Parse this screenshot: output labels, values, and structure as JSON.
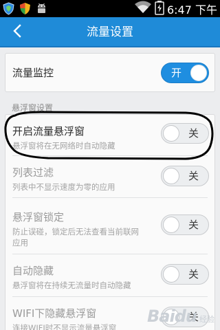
{
  "status_bar": {
    "time": "6:47 下午",
    "icons": [
      "shield-icon",
      "security-icon",
      "android-icon",
      "wifi-icon",
      "battery-charging-icon"
    ]
  },
  "header": {
    "title": "流量设置",
    "back_icon": "chevron-left-icon"
  },
  "traffic_monitor": {
    "label": "流量监控",
    "toggle": {
      "state": "on",
      "text": "开"
    }
  },
  "floating_section": {
    "label": "悬浮窗设置",
    "items": [
      {
        "title": "开启流量悬浮窗",
        "subtitle": "悬浮窗将在无网络时自动隐藏",
        "enabled": true,
        "toggle": {
          "state": "off",
          "text": "关"
        }
      },
      {
        "title": "列表过滤",
        "subtitle": "列表中不显示速度为零的应用",
        "enabled": false,
        "toggle": {
          "state": "off",
          "text": "关"
        }
      },
      {
        "title": "悬浮窗锁定",
        "subtitle": "防止误碰，锁定后无法查看当前联网\n应用",
        "subtitle_lines": [
          "防止误碰，锁定后无法查看当前联网",
          "应用"
        ],
        "enabled": false,
        "toggle": {
          "state": "off",
          "text": "关"
        }
      },
      {
        "title": "自动隐藏",
        "subtitle": "悬浮窗将在持续无流量时自动隐藏",
        "enabled": false,
        "toggle": {
          "state": "off",
          "text": "关"
        }
      },
      {
        "title": "WIFI下隐藏悬浮窗",
        "subtitle": "连接WIFI时不显示流量悬浮窗",
        "enabled": false,
        "toggle": {
          "state": "off",
          "text": "关"
        }
      }
    ]
  },
  "watermark": {
    "logo": "Baidu",
    "sub": "经验"
  },
  "colors": {
    "accent": "#1f8bd8",
    "toggle_on": "#1f8ee0",
    "background": "#ecedef",
    "highlight_stroke": "#000000"
  }
}
